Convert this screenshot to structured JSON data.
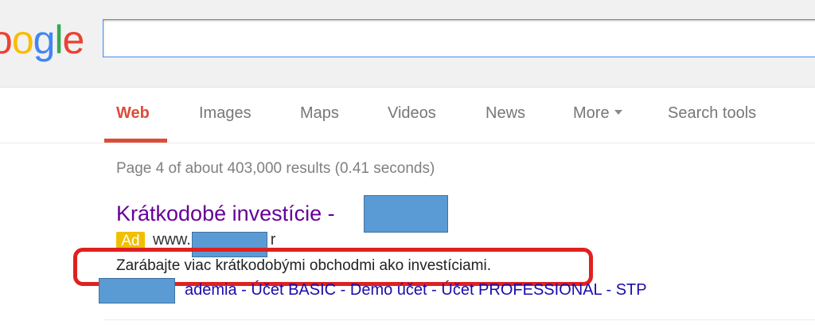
{
  "logo": {
    "letters": [
      "o",
      "o",
      "g",
      "l",
      "e"
    ],
    "colors": [
      "#ea4335",
      "#fbbc05",
      "#4285f4",
      "#34a853",
      "#ea4335"
    ]
  },
  "search": {
    "value": ""
  },
  "tabs": [
    {
      "label": "Web",
      "active": true
    },
    {
      "label": "Images"
    },
    {
      "label": "Maps"
    },
    {
      "label": "Videos"
    },
    {
      "label": "News"
    },
    {
      "label": "More"
    },
    {
      "label": "Search tools"
    }
  ],
  "stats": "Page 4 of about 403,000 results (0.41 seconds)",
  "ad": {
    "title": "Krátkodobé investície -",
    "badge": "Ad",
    "url_prefix": "www.",
    "url_suffix": "r",
    "description": "Zarábajte viac krátkodobými obchodmi ako investíciami.",
    "sitelinks": [
      "ademia",
      "Účet BASIC",
      "Demo účet",
      "Účet PROFESSIONAL",
      "STP"
    ],
    "sitelink_separator": " - "
  },
  "colors": {
    "accent_tab": "#dd4b39",
    "visited_link": "#660099",
    "link": "#1a0dab",
    "ad_badge": "#f0c000",
    "redaction": "#5b9bd5",
    "highlight": "#e02020"
  }
}
